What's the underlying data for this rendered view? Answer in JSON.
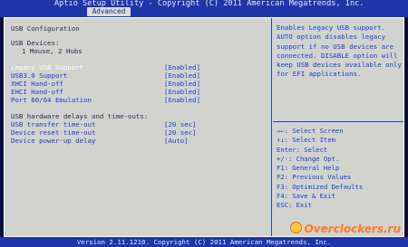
{
  "header": {
    "title": "Aptio Setup Utility - Copyright (C) 2011 American Megatrends, Inc.",
    "active_tab": "Advanced"
  },
  "section_title": "USB Configuration",
  "usb_devices": {
    "label": "USB Devices:",
    "value": "1 Mouse, 2 Hubs"
  },
  "settings": [
    {
      "label": "Legacy USB Support",
      "value": "[Enabled]",
      "selected": true
    },
    {
      "label": "USB3.0 Support",
      "value": "[Enabled]"
    },
    {
      "label": "XHCI Hand-off",
      "value": "[Enabled]"
    },
    {
      "label": "EHCI Hand-off",
      "value": "[Enabled]"
    },
    {
      "label": "Port 60/64 Emulation",
      "value": "[Enabled]"
    }
  ],
  "delays_header": "USB hardware delays and time-outs:",
  "delays": [
    {
      "label": "USB transfer time-out",
      "value": "[20 sec]"
    },
    {
      "label": "Device reset time-out",
      "value": "[20 sec]"
    },
    {
      "label": "Device power-up delay",
      "value": "[Auto]"
    }
  ],
  "help_text": "Enables Legacy USB support. AUTO option disables legacy support if no USB devices are connected. DISABLE option will keep USB devices available only for EFI applications.",
  "key_help": [
    "→←: Select Screen",
    "↑↓: Select Item",
    "Enter: Select",
    "+/-: Change Opt.",
    "F1: General Help",
    "F2: Previous Values",
    "F3: Optimized Defaults",
    "F4: Save & Exit",
    "ESC: Exit"
  ],
  "footer": "Version 2.11.1210. Copyright (C) 2011 American Megatrends, Inc.",
  "watermark": "Overclockers.ru",
  "colors": {
    "panel_bg": "#d2d3cf",
    "bar_bg": "#1e36a8",
    "option_text": "#1a3ccc",
    "label_text": "#2a2c48",
    "selected_text": "#ffffff"
  }
}
